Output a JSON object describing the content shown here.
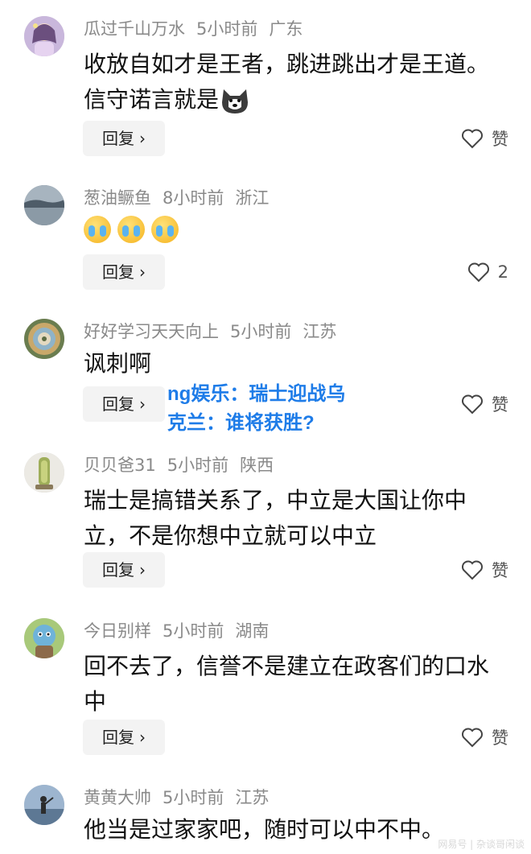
{
  "comments": [
    {
      "user": "瓜过千山万水",
      "time": "5小时前",
      "region": "广东",
      "lines": [
        "收放自如才是王者，跳进跳出才是王道。",
        "信守诺言就是"
      ],
      "like_label": "赞",
      "avatar": "girl-avatar"
    },
    {
      "user": "葱油鳜鱼",
      "time": "8小时前",
      "region": "浙江",
      "emoji": "crying-laugh-emoji",
      "like_count": "2",
      "avatar": "lake-avatar"
    },
    {
      "user": "好好学习天天向上",
      "time": "5小时前",
      "region": "江苏",
      "lines": [
        "讽刺啊"
      ],
      "like_label": "赞",
      "avatar": "spiral-avatar"
    },
    {
      "user": "贝贝爸31",
      "time": "5小时前",
      "region": "陕西",
      "lines": [
        "瑞士是搞错关系了，中立是大国让你中",
        "立，不是你想中立就可以中立"
      ],
      "like_label": "赞",
      "avatar": "jade-avatar"
    },
    {
      "user": "今日别样",
      "time": "5小时前",
      "region": "湖南",
      "lines": [
        "回不去了，信誉不是建立在政客们的口水",
        "中"
      ],
      "like_label": "赞",
      "avatar": "cartoon-avatar"
    },
    {
      "user": "黄黄大帅",
      "time": "5小时前",
      "region": "江苏",
      "lines": [
        "他当是过家家吧，随时可以中不中。"
      ],
      "avatar": "sunset-avatar"
    }
  ],
  "reply_label": "回复",
  "reply_chevron": "›",
  "overlay": {
    "line1": "ng娱乐：瑞士迎战乌",
    "line2": "克兰：谁将获胜?"
  },
  "watermark": "网易号 | 杂谈哥闲谈",
  "colors": {
    "meta_text": "#8a8a8a",
    "overlay_text": "#1e7ce8",
    "reply_bg": "#f3f3f3"
  }
}
